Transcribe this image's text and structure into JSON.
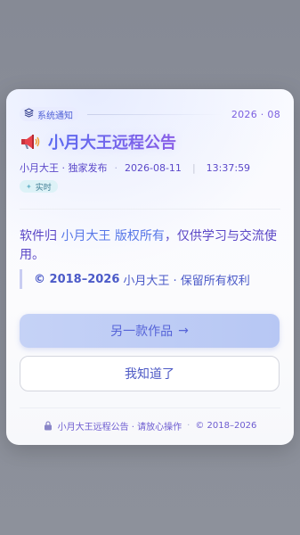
{
  "header": {
    "tag_label": "系统通知",
    "date_short": "2026 · 08"
  },
  "title": "小月大王远程公告",
  "meta": {
    "author": "小月大王 · 独家发布",
    "date": "2026-08-11",
    "time": "13:37:59"
  },
  "live_badge": "实时",
  "body": {
    "part1": "软件归 ",
    "owner": "小月大王",
    "part2": " ",
    "rights": "版权所有",
    "part3": "，仅供学习与交流使用。"
  },
  "quote": {
    "copyright": "© 2018–2026",
    "text": "小月大王 · 保留所有权利"
  },
  "buttons": {
    "primary_label": "另一款作品",
    "primary_arrow": "→",
    "secondary_label": "我知道了"
  },
  "footer": {
    "text": "小月大王远程公告 · 请放心操作",
    "copyright": "© 2018–2026"
  },
  "colors": {
    "accent": "#5a6cf0",
    "accent2": "#8a5ee6",
    "primary_btn": "#c5d2f6"
  },
  "icons": {
    "tag": "layers-icon",
    "title": "megaphone-icon",
    "live": "sparkle-icon",
    "footer": "lock-icon"
  }
}
